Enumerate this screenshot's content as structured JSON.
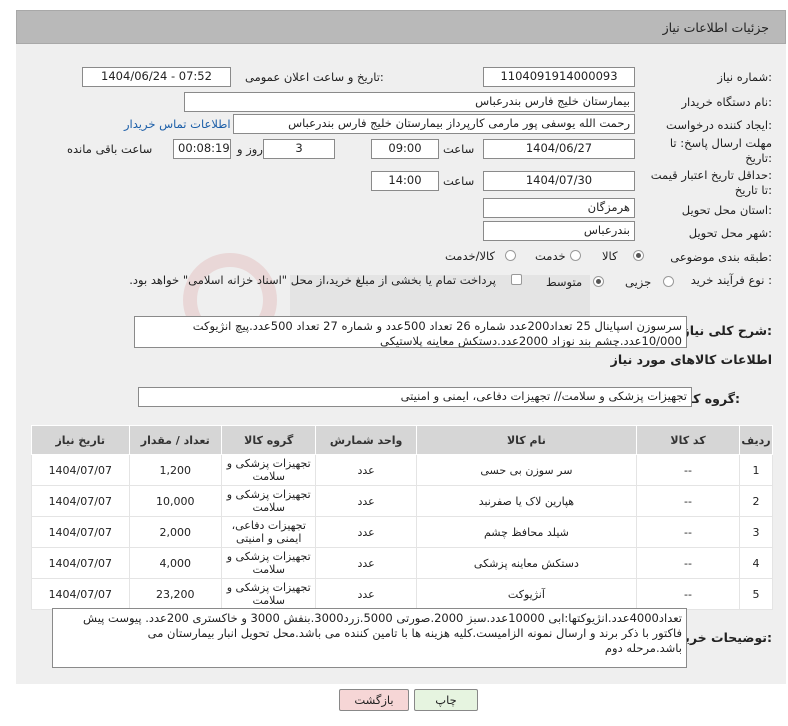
{
  "header": {
    "title": "جزئیات اطلاعات نیاز"
  },
  "form": {
    "need_number_label": "شماره نیاز:",
    "need_number": "1104091914000093",
    "announce_label": "تاریخ و ساعت اعلان عمومی:",
    "announce_value": "1404/06/24 - 07:52",
    "buyer_org_label": "نام دستگاه خریدار:",
    "buyer_org": "بیمارستان خلیج فارس بندرعباس",
    "creator_label": "ایجاد کننده درخواست:",
    "creator": "رحمت الله یوسفی پور مارمی کارپرداز بیمارستان خلیج فارس بندرعباس",
    "contact_link": "اطلاعات تماس خریدار",
    "deadline_label_1": "مهلت ارسال پاسخ: تا",
    "deadline_label_2": "تاریخ:",
    "deadline_date": "1404/06/27",
    "time_label": "ساعت",
    "deadline_time": "09:00",
    "days_value": "3",
    "days_label": "روز و",
    "remaining_time": "00:08:19",
    "remaining_label": "ساعت باقی مانده",
    "price_valid_label_1": "حداقل تاریخ اعتبار قیمت:",
    "price_valid_label_2": "تا تاریخ:",
    "price_valid_date": "1404/07/30",
    "price_valid_time": "14:00",
    "province_label": "استان محل تحویل:",
    "province": "هرمزگان",
    "city_label": "شهر محل تحویل:",
    "city": "بندرعباس",
    "category_label": "طبقه بندی موضوعی:",
    "category_options": [
      "کالا",
      "خدمت",
      "کالا/خدمت"
    ],
    "category_selected": "کالا",
    "process_label": "نوع فرآیند خرید :",
    "process_options": [
      "جزیی",
      "متوسط"
    ],
    "process_selected": "متوسط",
    "payment_note": "پرداخت تمام یا بخشی از مبلغ خرید،از محل \"اسناد خزانه اسلامی\" خواهد بود.",
    "summary_label": "شرح کلی نیاز:",
    "summary_line1": "سرسوزن اسپاینال 25 تعداد200عدد شماره 26 تعداد 500عدد و شماره 27 تعداد 500عدد.پیچ انژیوکت",
    "summary_line2": "10/000عدد.چشم بند نوزاد 2000عدد.دستکش معاینه پلاستیکی",
    "goods_info_title": "اطلاعات کالاهای مورد نیاز",
    "goods_group_label": "گروه کالا:",
    "goods_group": "تجهیزات پزشکی و سلامت// تجهیزات دفاعی، ایمنی و امنیتی"
  },
  "table": {
    "headers": [
      "ردیف",
      "کد کالا",
      "نام کالا",
      "واحد شمارش",
      "گروه کالا",
      "تعداد / مقدار",
      "تاریخ نیاز"
    ],
    "rows": [
      {
        "row": "1",
        "code": "--",
        "name": "سر سوزن بی حسی",
        "unit": "عدد",
        "group_1": "تجهیزات پزشکی و",
        "group_2": "سلامت",
        "qty": "1,200",
        "date": "1404/07/07"
      },
      {
        "row": "2",
        "code": "--",
        "name": "هپارین لاک یا صفرنبد",
        "unit": "عدد",
        "group_1": "تجهیزات پزشکی و",
        "group_2": "سلامت",
        "qty": "10,000",
        "date": "1404/07/07"
      },
      {
        "row": "3",
        "code": "--",
        "name": "شیلد محافظ چشم",
        "unit": "عدد",
        "group_1": "تجهیزات دفاعی،",
        "group_2": "ایمنی و امنیتی",
        "qty": "2,000",
        "date": "1404/07/07"
      },
      {
        "row": "4",
        "code": "--",
        "name": "دستکش معاینه پزشکی",
        "unit": "عدد",
        "group_1": "تجهیزات پزشکی و",
        "group_2": "سلامت",
        "qty": "4,000",
        "date": "1404/07/07"
      },
      {
        "row": "5",
        "code": "--",
        "name": "آنژیوکت",
        "unit": "عدد",
        "group_1": "تجهیزات پزشکی و",
        "group_2": "سلامت",
        "qty": "23,200",
        "date": "1404/07/07"
      }
    ]
  },
  "buyer_notes": {
    "label": "توضیحات خریدار:",
    "line1": "تعداد4000عدد.انژیوکتها:ابی 10000عدد.سبز 2000.صورتی 5000.زرد3000.بنفش 3000 و خاکستری 200عدد. پیوست پیش",
    "line2": "فاکتور با ذکر برند و ارسال نمونه الزامیست.کلیه هزینه ها با تامین کننده می باشد.محل تحویل انبار بیمارستان می",
    "line3": "باشد.مرحله دوم"
  },
  "buttons": {
    "print": "چاپ",
    "back": "بازگشت"
  },
  "colors": {
    "header_bg": "#b9b9b9",
    "panel_bg": "#efefef",
    "link": "#1b5ea8",
    "back_btn_bg": "#f6d6d6",
    "print_btn_bg": "#e6f4e0"
  }
}
